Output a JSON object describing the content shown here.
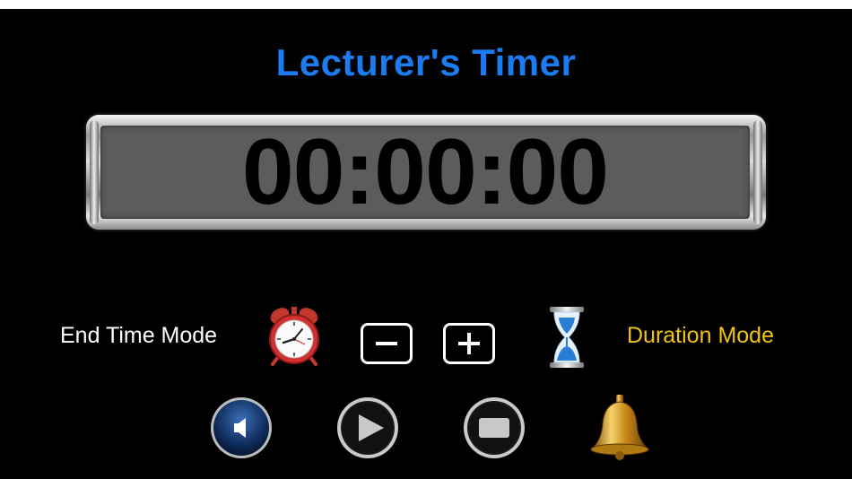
{
  "app": {
    "title": "Lecturer's Timer"
  },
  "timer": {
    "display": "00:00:00"
  },
  "modes": {
    "end_time_label": "End Time Mode",
    "duration_label": "Duration Mode",
    "end_time_icon": "alarm-clock-icon",
    "duration_icon": "hourglass-icon"
  },
  "controls": {
    "decrement_icon": "minus-icon",
    "increment_icon": "plus-icon",
    "sound_icon": "speaker-icon",
    "play_icon": "play-icon",
    "stop_icon": "stop-icon",
    "bell_icon": "bell-icon"
  },
  "colors": {
    "title": "#1a7cf0",
    "duration_mode": "#f2c30f",
    "end_time_mode": "#ffffff",
    "background": "#000000",
    "display_face": "#5c5c5a"
  }
}
